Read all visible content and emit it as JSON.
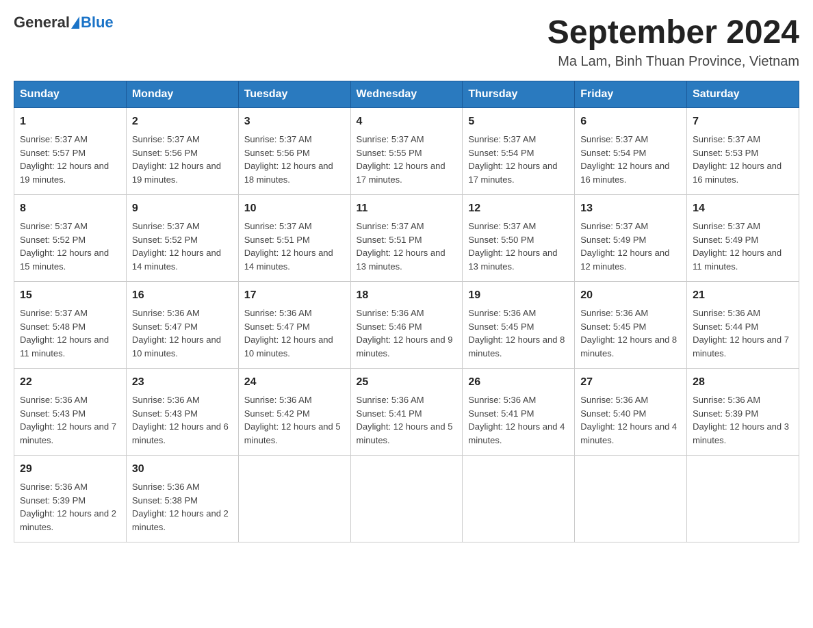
{
  "header": {
    "logo_general": "General",
    "logo_blue": "Blue",
    "title": "September 2024",
    "subtitle": "Ma Lam, Binh Thuan Province, Vietnam"
  },
  "days_of_week": [
    "Sunday",
    "Monday",
    "Tuesday",
    "Wednesday",
    "Thursday",
    "Friday",
    "Saturday"
  ],
  "weeks": [
    [
      {
        "day": "1",
        "sunrise": "Sunrise: 5:37 AM",
        "sunset": "Sunset: 5:57 PM",
        "daylight": "Daylight: 12 hours and 19 minutes."
      },
      {
        "day": "2",
        "sunrise": "Sunrise: 5:37 AM",
        "sunset": "Sunset: 5:56 PM",
        "daylight": "Daylight: 12 hours and 19 minutes."
      },
      {
        "day": "3",
        "sunrise": "Sunrise: 5:37 AM",
        "sunset": "Sunset: 5:56 PM",
        "daylight": "Daylight: 12 hours and 18 minutes."
      },
      {
        "day": "4",
        "sunrise": "Sunrise: 5:37 AM",
        "sunset": "Sunset: 5:55 PM",
        "daylight": "Daylight: 12 hours and 17 minutes."
      },
      {
        "day": "5",
        "sunrise": "Sunrise: 5:37 AM",
        "sunset": "Sunset: 5:54 PM",
        "daylight": "Daylight: 12 hours and 17 minutes."
      },
      {
        "day": "6",
        "sunrise": "Sunrise: 5:37 AM",
        "sunset": "Sunset: 5:54 PM",
        "daylight": "Daylight: 12 hours and 16 minutes."
      },
      {
        "day": "7",
        "sunrise": "Sunrise: 5:37 AM",
        "sunset": "Sunset: 5:53 PM",
        "daylight": "Daylight: 12 hours and 16 minutes."
      }
    ],
    [
      {
        "day": "8",
        "sunrise": "Sunrise: 5:37 AM",
        "sunset": "Sunset: 5:52 PM",
        "daylight": "Daylight: 12 hours and 15 minutes."
      },
      {
        "day": "9",
        "sunrise": "Sunrise: 5:37 AM",
        "sunset": "Sunset: 5:52 PM",
        "daylight": "Daylight: 12 hours and 14 minutes."
      },
      {
        "day": "10",
        "sunrise": "Sunrise: 5:37 AM",
        "sunset": "Sunset: 5:51 PM",
        "daylight": "Daylight: 12 hours and 14 minutes."
      },
      {
        "day": "11",
        "sunrise": "Sunrise: 5:37 AM",
        "sunset": "Sunset: 5:51 PM",
        "daylight": "Daylight: 12 hours and 13 minutes."
      },
      {
        "day": "12",
        "sunrise": "Sunrise: 5:37 AM",
        "sunset": "Sunset: 5:50 PM",
        "daylight": "Daylight: 12 hours and 13 minutes."
      },
      {
        "day": "13",
        "sunrise": "Sunrise: 5:37 AM",
        "sunset": "Sunset: 5:49 PM",
        "daylight": "Daylight: 12 hours and 12 minutes."
      },
      {
        "day": "14",
        "sunrise": "Sunrise: 5:37 AM",
        "sunset": "Sunset: 5:49 PM",
        "daylight": "Daylight: 12 hours and 11 minutes."
      }
    ],
    [
      {
        "day": "15",
        "sunrise": "Sunrise: 5:37 AM",
        "sunset": "Sunset: 5:48 PM",
        "daylight": "Daylight: 12 hours and 11 minutes."
      },
      {
        "day": "16",
        "sunrise": "Sunrise: 5:36 AM",
        "sunset": "Sunset: 5:47 PM",
        "daylight": "Daylight: 12 hours and 10 minutes."
      },
      {
        "day": "17",
        "sunrise": "Sunrise: 5:36 AM",
        "sunset": "Sunset: 5:47 PM",
        "daylight": "Daylight: 12 hours and 10 minutes."
      },
      {
        "day": "18",
        "sunrise": "Sunrise: 5:36 AM",
        "sunset": "Sunset: 5:46 PM",
        "daylight": "Daylight: 12 hours and 9 minutes."
      },
      {
        "day": "19",
        "sunrise": "Sunrise: 5:36 AM",
        "sunset": "Sunset: 5:45 PM",
        "daylight": "Daylight: 12 hours and 8 minutes."
      },
      {
        "day": "20",
        "sunrise": "Sunrise: 5:36 AM",
        "sunset": "Sunset: 5:45 PM",
        "daylight": "Daylight: 12 hours and 8 minutes."
      },
      {
        "day": "21",
        "sunrise": "Sunrise: 5:36 AM",
        "sunset": "Sunset: 5:44 PM",
        "daylight": "Daylight: 12 hours and 7 minutes."
      }
    ],
    [
      {
        "day": "22",
        "sunrise": "Sunrise: 5:36 AM",
        "sunset": "Sunset: 5:43 PM",
        "daylight": "Daylight: 12 hours and 7 minutes."
      },
      {
        "day": "23",
        "sunrise": "Sunrise: 5:36 AM",
        "sunset": "Sunset: 5:43 PM",
        "daylight": "Daylight: 12 hours and 6 minutes."
      },
      {
        "day": "24",
        "sunrise": "Sunrise: 5:36 AM",
        "sunset": "Sunset: 5:42 PM",
        "daylight": "Daylight: 12 hours and 5 minutes."
      },
      {
        "day": "25",
        "sunrise": "Sunrise: 5:36 AM",
        "sunset": "Sunset: 5:41 PM",
        "daylight": "Daylight: 12 hours and 5 minutes."
      },
      {
        "day": "26",
        "sunrise": "Sunrise: 5:36 AM",
        "sunset": "Sunset: 5:41 PM",
        "daylight": "Daylight: 12 hours and 4 minutes."
      },
      {
        "day": "27",
        "sunrise": "Sunrise: 5:36 AM",
        "sunset": "Sunset: 5:40 PM",
        "daylight": "Daylight: 12 hours and 4 minutes."
      },
      {
        "day": "28",
        "sunrise": "Sunrise: 5:36 AM",
        "sunset": "Sunset: 5:39 PM",
        "daylight": "Daylight: 12 hours and 3 minutes."
      }
    ],
    [
      {
        "day": "29",
        "sunrise": "Sunrise: 5:36 AM",
        "sunset": "Sunset: 5:39 PM",
        "daylight": "Daylight: 12 hours and 2 minutes."
      },
      {
        "day": "30",
        "sunrise": "Sunrise: 5:36 AM",
        "sunset": "Sunset: 5:38 PM",
        "daylight": "Daylight: 12 hours and 2 minutes."
      },
      null,
      null,
      null,
      null,
      null
    ]
  ]
}
